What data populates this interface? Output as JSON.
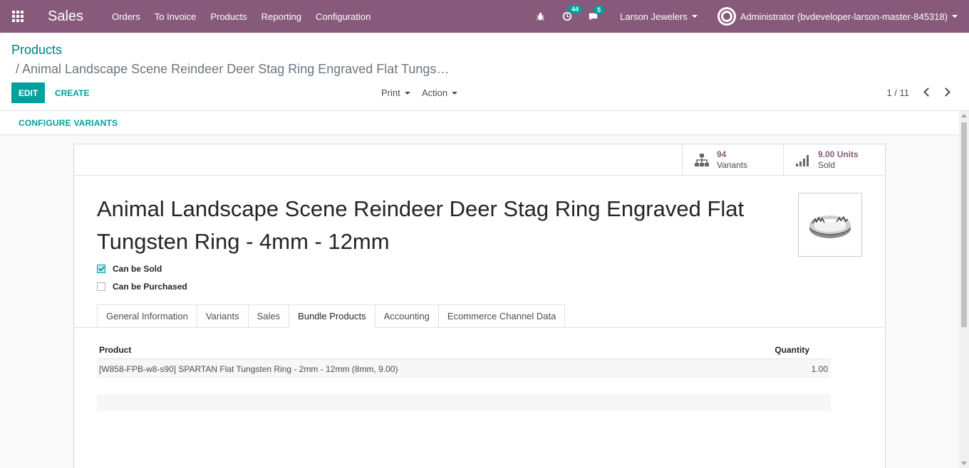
{
  "navbar": {
    "app_name": "Sales",
    "menu": [
      "Orders",
      "To Invoice",
      "Products",
      "Reporting",
      "Configuration"
    ],
    "activity_count": "44",
    "message_count": "5",
    "company": "Larson Jewelers",
    "user": "Administrator (bvdeveloper-larson-master-845318)"
  },
  "control_panel": {
    "breadcrumb_root": "Products",
    "breadcrumb_current": "/ Animal Landscape Scene Reindeer Deer Stag Ring Engraved Flat Tungs…",
    "edit_label": "EDIT",
    "create_label": "CREATE",
    "print_label": "Print",
    "action_label": "Action",
    "pager": "1 / 11"
  },
  "status_bar": {
    "configure_label": "CONFIGURE VARIANTS"
  },
  "stat_buttons": {
    "variants_value": "94",
    "variants_label": "Variants",
    "sold_value": "9.00 Units",
    "sold_label": "Sold"
  },
  "product": {
    "title": "Animal Landscape Scene Reindeer Deer Stag Ring Engraved Flat Tungsten Ring - 4mm - 12mm",
    "can_be_sold_label": "Can be Sold",
    "can_be_sold": true,
    "can_be_purchased_label": "Can be Purchased",
    "can_be_purchased": false
  },
  "tabs": [
    {
      "label": "General Information",
      "active": false
    },
    {
      "label": "Variants",
      "active": false
    },
    {
      "label": "Sales",
      "active": false
    },
    {
      "label": "Bundle Products",
      "active": true
    },
    {
      "label": "Accounting",
      "active": false
    },
    {
      "label": "Ecommerce Channel Data",
      "active": false
    }
  ],
  "bundle_table": {
    "headers": {
      "product": "Product",
      "quantity": "Quantity"
    },
    "rows": [
      {
        "product": "[W858-FPB-w8-s90] SPARTAN Flat Tungsten Ring - 2mm - 12mm (8mm, 9.00)",
        "quantity": "1.00"
      }
    ]
  },
  "colors": {
    "navbar": "#875a7b",
    "accent": "#00a09d",
    "link": "#017e84"
  }
}
